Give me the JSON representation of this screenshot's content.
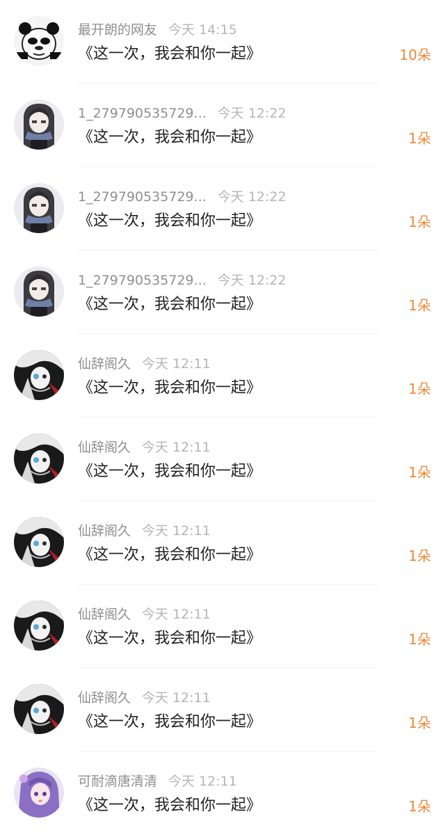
{
  "comments": [
    {
      "name": "最开朗的网友",
      "time": "今天 14:15",
      "content": "《这一次，我会和你一起》",
      "gift": "10朵",
      "avatar": "panda-meme-avatar-icon"
    },
    {
      "name": "1_279790535729...",
      "time": "今天 12:22",
      "content": "《这一次，我会和你一起》",
      "gift": "1朵",
      "avatar": "anime-girl-scarf-avatar-icon"
    },
    {
      "name": "1_279790535729...",
      "time": "今天 12:22",
      "content": "《这一次，我会和你一起》",
      "gift": "1朵",
      "avatar": "anime-girl-scarf-avatar-icon"
    },
    {
      "name": "1_279790535729...",
      "time": "今天 12:22",
      "content": "《这一次，我会和你一起》",
      "gift": "1朵",
      "avatar": "anime-girl-scarf-avatar-icon"
    },
    {
      "name": "仙辞阁久",
      "time": "今天 12:11",
      "content": "《这一次，我会和你一起》",
      "gift": "1朵",
      "avatar": "monochrome-anime-avatar-icon"
    },
    {
      "name": "仙辞阁久",
      "time": "今天 12:11",
      "content": "《这一次，我会和你一起》",
      "gift": "1朵",
      "avatar": "monochrome-anime-avatar-icon"
    },
    {
      "name": "仙辞阁久",
      "time": "今天 12:11",
      "content": "《这一次，我会和你一起》",
      "gift": "1朵",
      "avatar": "monochrome-anime-avatar-icon"
    },
    {
      "name": "仙辞阁久",
      "time": "今天 12:11",
      "content": "《这一次，我会和你一起》",
      "gift": "1朵",
      "avatar": "monochrome-anime-avatar-icon"
    },
    {
      "name": "仙辞阁久",
      "time": "今天 12:11",
      "content": "《这一次，我会和你一起》",
      "gift": "1朵",
      "avatar": "monochrome-anime-avatar-icon"
    },
    {
      "name": "可耐滴唐清清",
      "time": "今天 12:11",
      "content": "《这一次，我会和你一起》",
      "gift": "1朵",
      "avatar": "purple-hair-anime-avatar-icon"
    }
  ],
  "colors": {
    "background": "#ffffff",
    "name": "#8f8f8f",
    "time": "#b5b5b5",
    "content": "#222222",
    "gift": "#ee8a3a",
    "divider": "#f1f1f1"
  }
}
